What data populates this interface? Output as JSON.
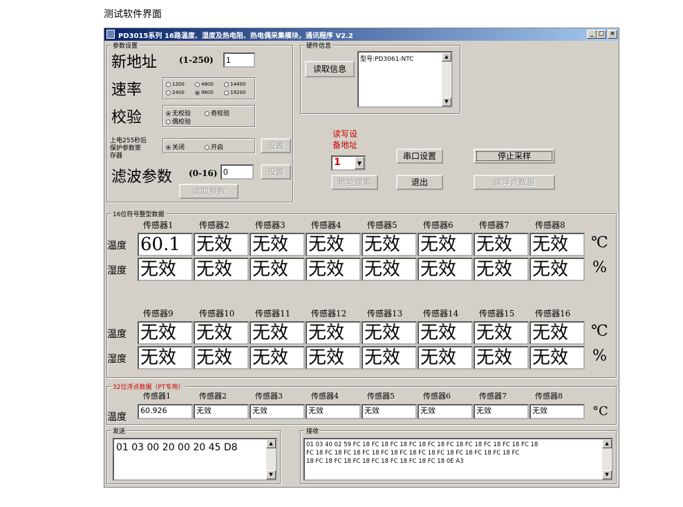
{
  "caption": "测试软件界面",
  "window": {
    "title": "PD3015系列 16路温度、湿度及热电阻、热电偶采集模块，通讯程序 V2.2",
    "minimize": "_",
    "maximize": "□",
    "close": "×"
  },
  "params": {
    "group_label": "参数设置",
    "new_address_label": "新地址",
    "new_address_range": "(1-250)",
    "new_address_value": "1",
    "baud_label": "速率",
    "baud_options": [
      "1200",
      "4800",
      "14400",
      "2400",
      "9600",
      "19200"
    ],
    "baud_selected": "9600",
    "parity_label": "校验",
    "parity_options": [
      "无校验",
      "奇校验",
      "偶校验"
    ],
    "parity_selected": "无校验",
    "protect_label_1": "上电255秒后",
    "protect_label_2": "保护参数寄",
    "protect_label_3": "存器",
    "protect_options": [
      "关闭",
      "开启"
    ],
    "protect_selected": "关闭",
    "set_button_1": "设置",
    "filter_label": "滤波参数",
    "filter_range": "(0-16)",
    "filter_value": "0",
    "set_button_2": "设置",
    "read_params_button": "读取参数"
  },
  "hardware": {
    "group_label": "硬件信息",
    "read_info_button": "读取信息",
    "info_text": "型号:PD3061-NTC"
  },
  "controls": {
    "rw_label_1": "读写设",
    "rw_label_2": "备地址",
    "device_address": "1",
    "address_search_button": "地址搜索",
    "serial_settings_button": "串口设置",
    "exit_button": "退出",
    "stop_sampling_button": "停止采样",
    "read_float_button": "读浮点数据"
  },
  "int16": {
    "group_label": "16位符号整型数据",
    "headers_a": [
      "传感器1",
      "传感器2",
      "传感器3",
      "传感器4",
      "传感器5",
      "传感器6",
      "传感器7",
      "传感器8"
    ],
    "headers_b": [
      "传感器9",
      "传感器10",
      "传感器11",
      "传感器12",
      "传感器13",
      "传感器14",
      "传感器15",
      "传感器16"
    ],
    "temp_label": "温度",
    "hum_label": "湿度",
    "temp_unit": "℃",
    "hum_unit": "%",
    "temp_a": [
      "60.1",
      "无效",
      "无效",
      "无效",
      "无效",
      "无效",
      "无效",
      "无效"
    ],
    "hum_a": [
      "无效",
      "无效",
      "无效",
      "无效",
      "无效",
      "无效",
      "无效",
      "无效"
    ],
    "temp_b": [
      "无效",
      "无效",
      "无效",
      "无效",
      "无效",
      "无效",
      "无效",
      "无效"
    ],
    "hum_b": [
      "无效",
      "无效",
      "无效",
      "无效",
      "无效",
      "无效",
      "无效",
      "无效"
    ]
  },
  "float32": {
    "group_label": "32位浮点数据（PT专用）",
    "headers": [
      "传感器1",
      "传感器2",
      "传感器3",
      "传感器4",
      "传感器5",
      "传感器6",
      "传感器7",
      "传感器8"
    ],
    "temp_label": "温度",
    "temp_unit": "°C",
    "values": [
      "60.926",
      "无效",
      "无效",
      "无效",
      "无效",
      "无效",
      "无效",
      "无效"
    ]
  },
  "send": {
    "group_label": "发送",
    "text": "01 03 00 20 00 20 45 D8"
  },
  "receive": {
    "group_label": "接收",
    "line1": "01 03 40 02 59 FC 18 FC 18 FC 18 FC 18 FC 18 FC 18 FC 18 FC 18 FC 18 FC 18",
    "line2": "FC 18 FC 18 FC 18 FC 18 FC 18 FC 18 FC 18 FC 18 FC 18 FC 18 FC 18 FC",
    "line3": "18 FC 18 FC 18 FC 18 FC 18 FC 18 FC 18 FC 18 0E A3"
  },
  "colors": {
    "window_bg": "#d4d0c8",
    "title_start": "#0a246a",
    "title_end": "#a6caf0",
    "accent_red": "#cc0000"
  }
}
